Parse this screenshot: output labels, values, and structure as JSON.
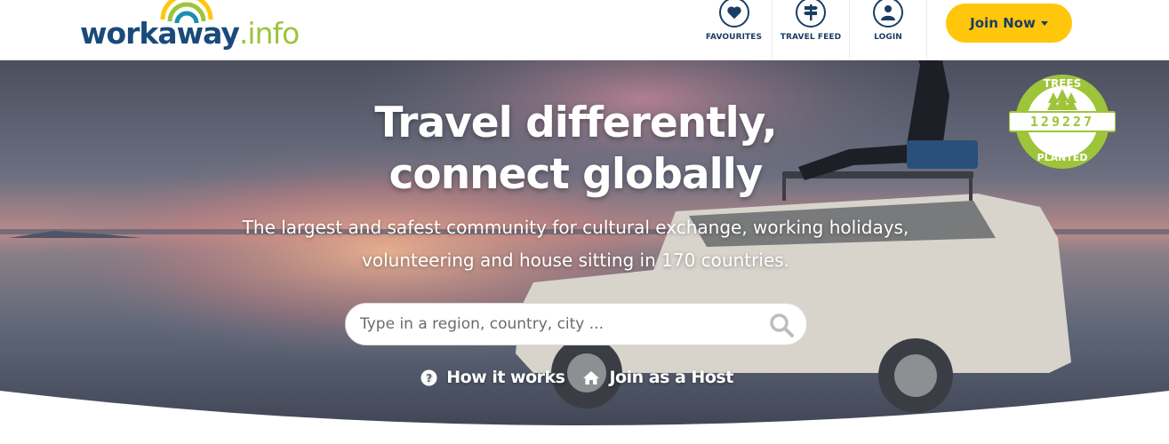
{
  "header": {
    "logo": {
      "main": "workaway",
      "tld": ".info"
    },
    "nav": [
      {
        "label": "FAVOURITES",
        "icon": "heart-icon"
      },
      {
        "label": "TRAVEL FEED",
        "icon": "signpost-icon"
      },
      {
        "label": "LOGIN",
        "icon": "user-icon"
      }
    ],
    "join_label": "Join Now"
  },
  "hero": {
    "title_line1": "Travel differently,",
    "title_line2": "connect globally",
    "subtitle_line1": "The largest and safest community for cultural exchange, working holidays,",
    "subtitle_line2": "volunteering and house sitting in 170 countries.",
    "search_placeholder": "Type in a region, country, city ...",
    "links": [
      {
        "label": "How it works",
        "icon": "question-circle-icon"
      },
      {
        "label": "Join as a Host",
        "icon": "home-icon"
      }
    ],
    "badge": {
      "top": "TREES",
      "count": "129227",
      "bottom": "PLANTED"
    }
  },
  "colors": {
    "brand_navy": "#1a3d63",
    "brand_green": "#9ec43a",
    "accent_yellow": "#ffc60b"
  }
}
